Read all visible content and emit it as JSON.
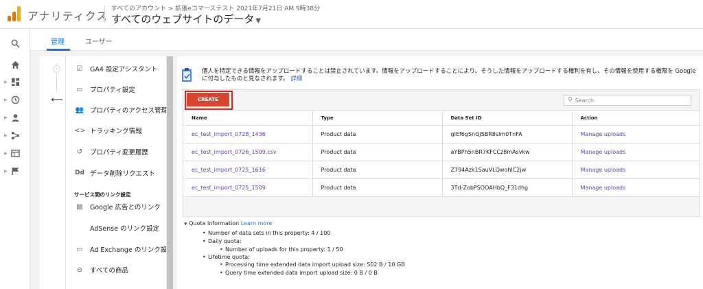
{
  "header": {
    "app_name": "アナリティクス",
    "breadcrumb": "すべてのアカウント > 拡張eコマーステスト 2021年7月21日 AM 9時38分",
    "property": "すべてのウェブサイトのデータ",
    "logo_colors": [
      "#f9ab00",
      "#e37400",
      "#e37400"
    ]
  },
  "tabs": [
    {
      "label": "管理",
      "active": true
    },
    {
      "label": "ユーザー",
      "active": false
    }
  ],
  "left_nav_icons": [
    "search-icon",
    "home-icon",
    "dashboard-icon",
    "clock-icon",
    "person-icon",
    "acquisition-icon",
    "behavior-icon",
    "flag-icon"
  ],
  "property_nav": {
    "items": [
      {
        "label": "GA4 設定アシスタント",
        "icon": "checklist-icon"
      },
      {
        "label": "プロパティ設定",
        "icon": "property-settings-icon"
      },
      {
        "label": "プロパティのアクセス管理",
        "icon": "group-icon"
      },
      {
        "label": "トラッキング情報",
        "icon": "code-icon"
      },
      {
        "label": "プロパティ変更履歴",
        "icon": "history-icon"
      },
      {
        "label": "データ削除リクエスト",
        "icon": "dd-icon"
      }
    ],
    "section_label": "サービス間のリンク設定",
    "links": [
      {
        "label": "Google 広告とのリンク",
        "icon": "ads-icon"
      },
      {
        "label": "AdSense のリンク設定",
        "icon": ""
      },
      {
        "label": "Ad Exchange のリンク設定",
        "icon": "adx-icon"
      },
      {
        "label": "すべての商品",
        "icon": "products-icon"
      }
    ]
  },
  "notice": {
    "text": "個人を特定できる情報をアップロードすることは禁止されています。情報をアップロードすることにより、そうした情報をアップロードする権利を有し、その情報を使用する権限を Google に付与したものと見なされます。",
    "link": "詳細"
  },
  "toolbar": {
    "create_label": "CREATE",
    "search_placeholder": "Search"
  },
  "table": {
    "columns": [
      "Name",
      "Type",
      "Data Set ID",
      "Action"
    ],
    "rows": [
      [
        "ec_test_import_0728_1436",
        "Product data",
        "gIEf6gSnQjSBR8sIm0TnFA",
        "Manage uploads"
      ],
      [
        "ec_test_import_0726_1509.csv",
        "Product data",
        "aYBPh5nBR7KFCCz8mAsvkw",
        "Manage uploads"
      ],
      [
        "ec_test_import_0725_1616",
        "Product data",
        "Z794Azk1SauVLQwohIC2jw",
        "Manage uploads"
      ],
      [
        "ec_test_import_0725_1509",
        "Product data",
        "3Td-ZobPSOOAHbQ_F31dhg",
        "Manage uploads"
      ]
    ]
  },
  "quota": {
    "title": "Quota information",
    "learn_more": "Learn more",
    "line1": "Number of data sets in this property: 4 / 100",
    "line2": "Daily quota:",
    "line3": "Number of uploads for this property: 1 / 50",
    "line4": "Lifetime quota:",
    "line5": "Processing time extended data import upload size: 502 B / 10 GB",
    "line6": "Query time extended data import upload size: 0 B / 0 B"
  }
}
